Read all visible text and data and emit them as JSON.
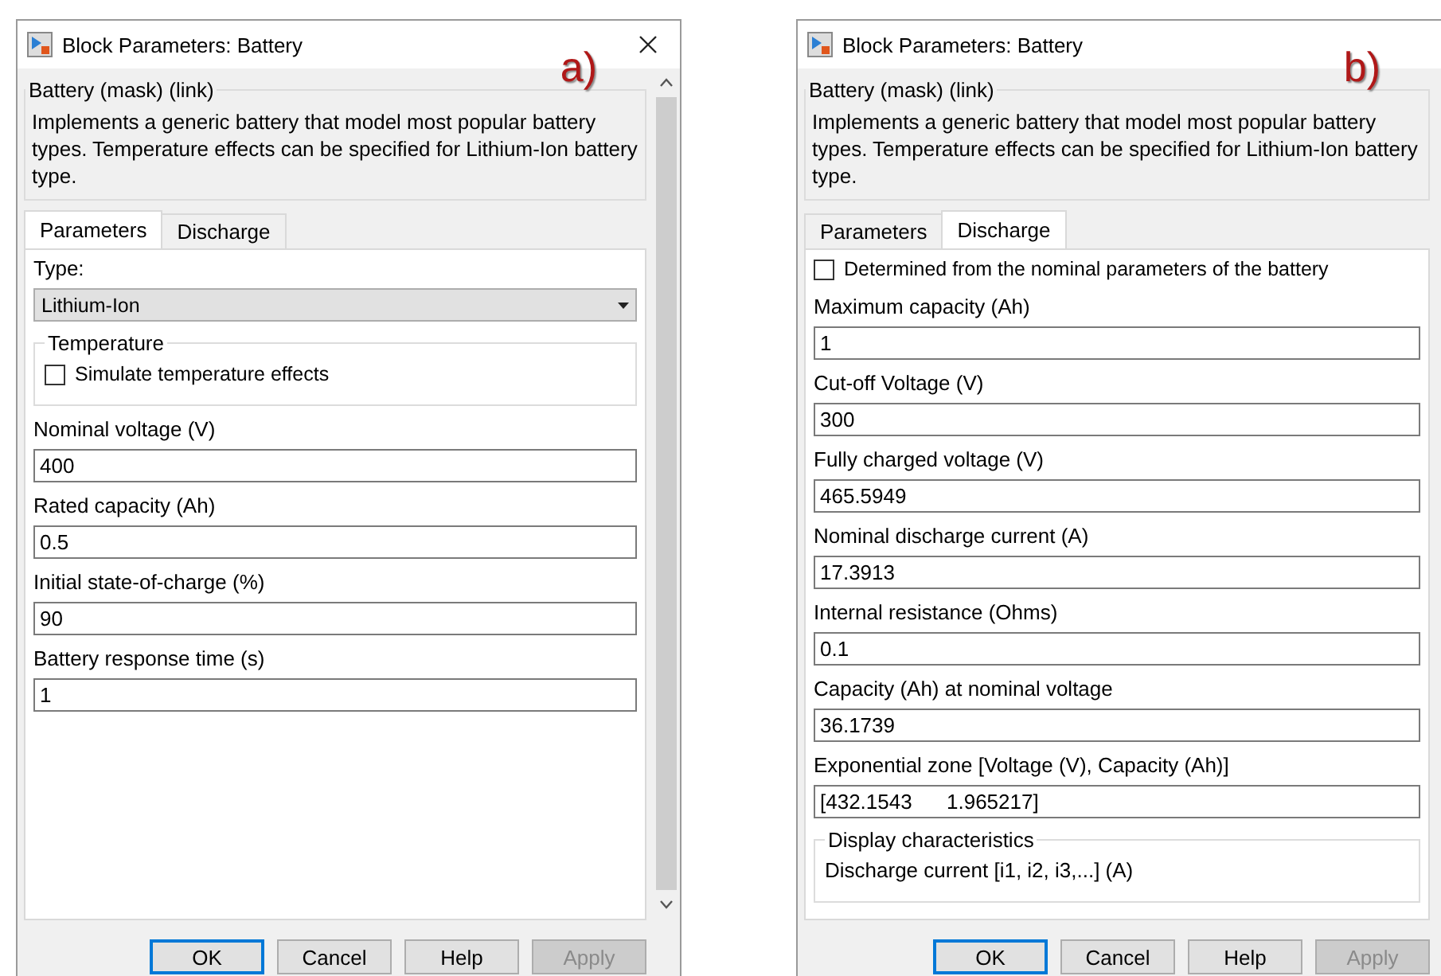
{
  "dialogs": [
    {
      "annotation": "a)",
      "title": "Block Parameters: Battery",
      "mask_title": "Battery (mask) (link)",
      "description": "Implements a generic battery that model most popular battery types. Temperature effects can be specified for Lithium-Ion battery type.",
      "tabs": [
        {
          "label": "Parameters",
          "selected": true
        },
        {
          "label": "Discharge",
          "selected": false
        }
      ],
      "items": [
        {
          "kind": "dropdown",
          "label": "Type:",
          "value": "Lithium-Ion"
        },
        {
          "kind": "group",
          "title": "Temperature",
          "items": [
            {
              "kind": "checkbox",
              "label": "Simulate temperature effects",
              "checked": false
            }
          ]
        },
        {
          "kind": "field",
          "label": "Nominal voltage (V)",
          "value": "400"
        },
        {
          "kind": "field",
          "label": "Rated capacity (Ah)",
          "value": "0.5"
        },
        {
          "kind": "field",
          "label": "Initial state-of-charge (%)",
          "value": "90"
        },
        {
          "kind": "field",
          "label": "Battery response time (s)",
          "value": "1"
        }
      ],
      "buttons": [
        {
          "label": "OK",
          "default": true,
          "disabled": false
        },
        {
          "label": "Cancel",
          "default": false,
          "disabled": false
        },
        {
          "label": "Help",
          "default": false,
          "disabled": false
        },
        {
          "label": "Apply",
          "default": false,
          "disabled": true
        }
      ]
    },
    {
      "annotation": "b)",
      "title": "Block Parameters: Battery",
      "mask_title": "Battery (mask) (link)",
      "description": "Implements a generic battery that model most popular battery types. Temperature effects can be specified for Lithium-Ion battery type.",
      "tabs": [
        {
          "label": "Parameters",
          "selected": false
        },
        {
          "label": "Discharge",
          "selected": true
        }
      ],
      "items": [
        {
          "kind": "checkbox",
          "label": "Determined from the nominal parameters of the battery",
          "checked": false
        },
        {
          "kind": "field",
          "label": "Maximum capacity (Ah)",
          "value": "1"
        },
        {
          "kind": "field",
          "label": "Cut-off Voltage (V)",
          "value": "300"
        },
        {
          "kind": "field",
          "label": "Fully charged voltage (V)",
          "value": "465.5949"
        },
        {
          "kind": "field",
          "label": "Nominal discharge current (A)",
          "value": "17.3913"
        },
        {
          "kind": "field",
          "label": "Internal resistance (Ohms)",
          "value": "0.1"
        },
        {
          "kind": "field",
          "label": "Capacity (Ah) at nominal voltage",
          "value": "36.1739"
        },
        {
          "kind": "field",
          "label": "Exponential zone [Voltage (V), Capacity (Ah)]",
          "value": "[432.1543      1.965217]"
        },
        {
          "kind": "group",
          "title": "Display characteristics",
          "items": [
            {
              "kind": "text",
              "label": "Discharge current [i1, i2, i3,...] (A)"
            }
          ]
        }
      ],
      "buttons": [
        {
          "label": "OK",
          "default": true,
          "disabled": false
        },
        {
          "label": "Cancel",
          "default": false,
          "disabled": false
        },
        {
          "label": "Help",
          "default": false,
          "disabled": false
        },
        {
          "label": "Apply",
          "default": false,
          "disabled": true
        }
      ]
    }
  ]
}
